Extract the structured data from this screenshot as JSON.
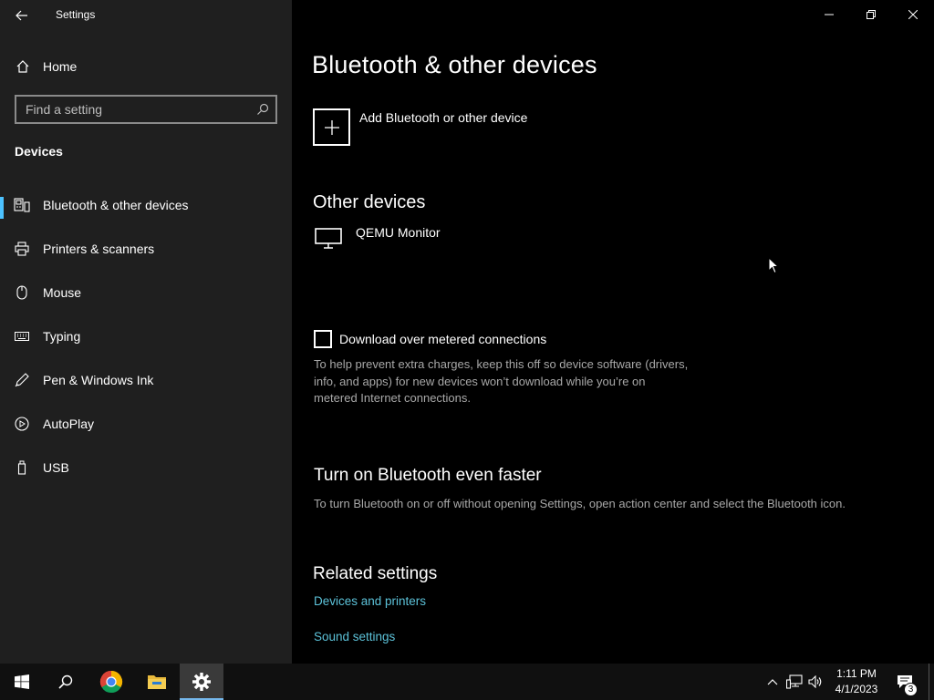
{
  "window": {
    "title": "Settings"
  },
  "sidebar": {
    "home_label": "Home",
    "search_placeholder": "Find a setting",
    "section_heading": "Devices",
    "items": [
      {
        "label": "Bluetooth & other devices",
        "icon": "bluetooth-devices-icon",
        "selected": true
      },
      {
        "label": "Printers & scanners",
        "icon": "printer-icon",
        "selected": false
      },
      {
        "label": "Mouse",
        "icon": "mouse-icon",
        "selected": false
      },
      {
        "label": "Typing",
        "icon": "keyboard-icon",
        "selected": false
      },
      {
        "label": "Pen & Windows Ink",
        "icon": "pen-icon",
        "selected": false
      },
      {
        "label": "AutoPlay",
        "icon": "autoplay-icon",
        "selected": false
      },
      {
        "label": "USB",
        "icon": "usb-icon",
        "selected": false
      }
    ]
  },
  "main": {
    "page_title": "Bluetooth & other devices",
    "add_device_label": "Add Bluetooth or other device",
    "other_devices_heading": "Other devices",
    "device_name": "QEMU Monitor",
    "metered_label": "Download over metered connections",
    "metered_checked": false,
    "metered_desc_lines": [
      "To help prevent extra charges, keep this off so device software (drivers,",
      "info, and apps) for new devices won’t download while you’re on",
      "metered Internet connections."
    ],
    "faster_heading": "Turn on Bluetooth even faster",
    "faster_desc": "To turn Bluetooth on or off without opening Settings, open action center and select the Bluetooth icon.",
    "related_heading": "Related settings",
    "related_links": [
      "Devices and printers",
      "Sound settings"
    ]
  },
  "taskbar": {
    "time": "1:11 PM",
    "date": "4/1/2023",
    "notification_count": "3",
    "pinned": [
      "windows-start-icon",
      "search-icon",
      "chrome-icon",
      "file-explorer-icon",
      "settings-gear-icon"
    ]
  },
  "colors": {
    "accent": "#4cc2ff",
    "link": "#5cc2d9",
    "sidebar_bg": "#1f1f1f",
    "main_bg": "#000000",
    "taskbar_bg": "#101010"
  }
}
